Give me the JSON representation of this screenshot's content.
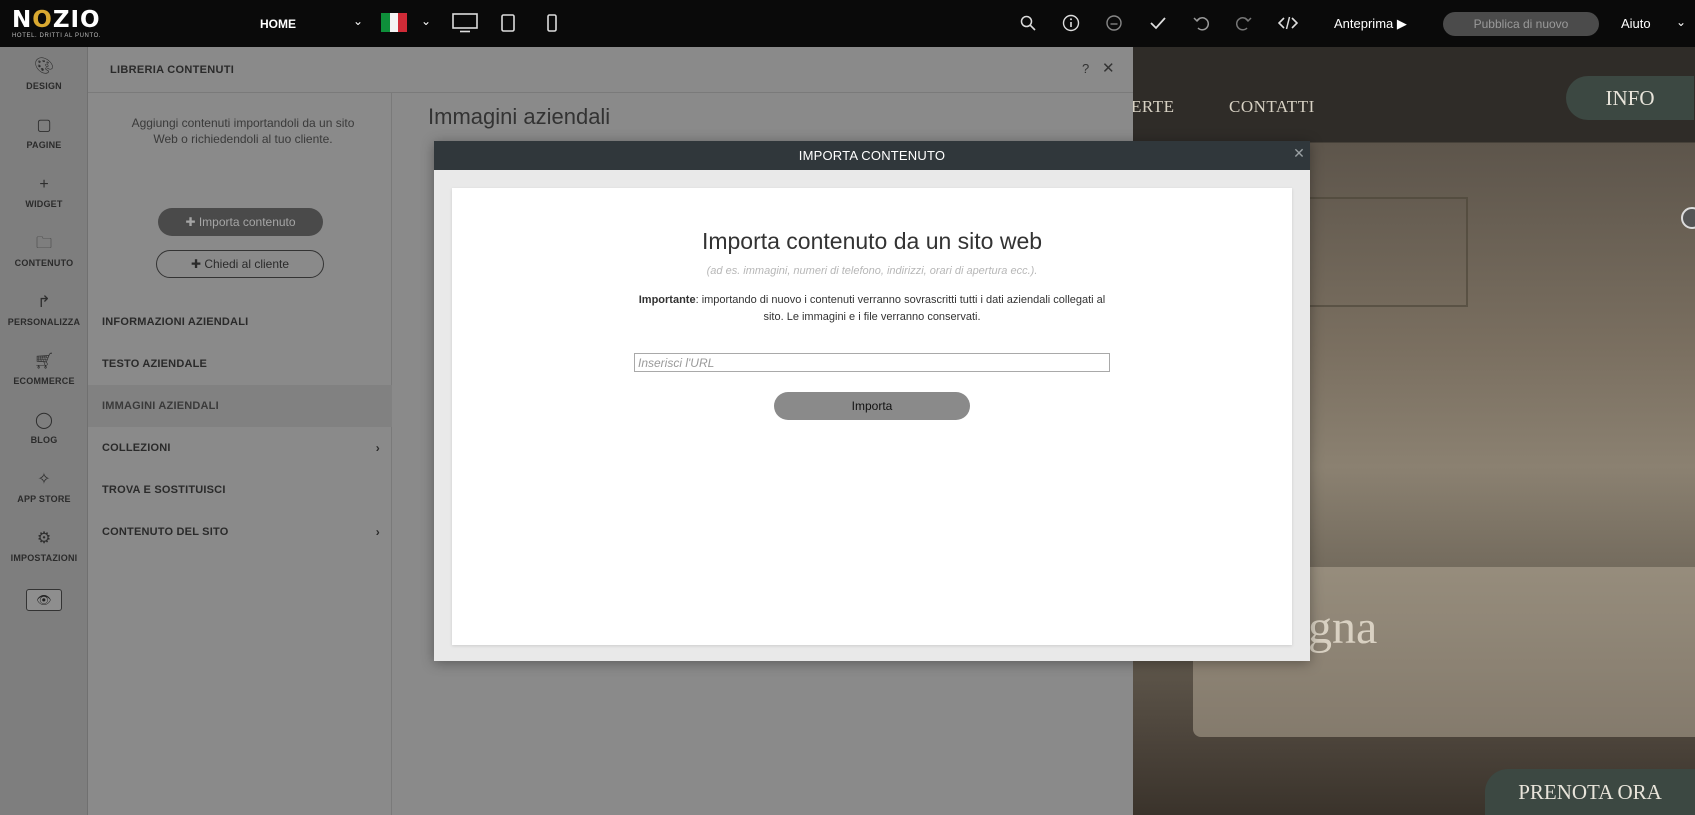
{
  "topbar": {
    "logo_word_pre": "N",
    "logo_word_o": "O",
    "logo_word_post": "ZIO",
    "logo_tagline": "HOTEL. DRITTI AL PUNTO.",
    "page_select": "HOME",
    "preview_label": "Anteprima ▶",
    "publish_label": "Pubblica di nuovo",
    "help_label": "Aiuto",
    "caret": "⌄",
    "flag_colors": [
      "#0e8f3a",
      "#f4f4f4",
      "#cf2b37"
    ]
  },
  "rail": {
    "items": [
      {
        "label": "DESIGN",
        "icon": "palette-icon",
        "glyph": "🎨︎"
      },
      {
        "label": "PAGINE",
        "icon": "pages-icon",
        "glyph": "▢"
      },
      {
        "label": "WIDGET",
        "icon": "plus-icon",
        "glyph": "+"
      },
      {
        "label": "CONTENUTO",
        "icon": "folder-icon",
        "glyph": "🗀"
      },
      {
        "label": "PERSONALIZZA",
        "icon": "route-icon",
        "glyph": "↱"
      },
      {
        "label": "ECOMMERCE",
        "icon": "cart-icon",
        "glyph": "🛒︎"
      },
      {
        "label": "BLOG",
        "icon": "chat-bubble-icon",
        "glyph": "◯"
      },
      {
        "label": "APP STORE",
        "icon": "puzzle-icon",
        "glyph": "✧"
      },
      {
        "label": "IMPOSTAZIONI",
        "icon": "gear-icon",
        "glyph": "⚙"
      }
    ],
    "eye_glyph": "👁︎"
  },
  "panel": {
    "title": "LIBRERIA CONTENUTI",
    "help": "?",
    "close": "✕",
    "description": "Aggiungi contenuti importandoli da un sito Web o richiedendoli al tuo cliente.",
    "import_button": "✚  Importa contenuto",
    "ask_button": "✚  Chiedi al cliente",
    "menu": [
      {
        "label": "INFORMAZIONI AZIENDALI",
        "chevron": ""
      },
      {
        "label": "TESTO AZIENDALE",
        "chevron": ""
      },
      {
        "label": "IMMAGINI AZIENDALI",
        "chevron": ""
      },
      {
        "label": "COLLEZIONI",
        "chevron": "›"
      },
      {
        "label": "TROVA E SOSTITUISCI",
        "chevron": ""
      },
      {
        "label": "CONTENUTO DEL SITO",
        "chevron": "›"
      }
    ],
    "main_title": "Immagini aziendali"
  },
  "preview": {
    "nav_offerte": "ERTE",
    "nav_contatti": "CONTATTI",
    "info_button": "INFO",
    "hero_text": "gna",
    "prenota_button": "PRENOTA ORA"
  },
  "modal": {
    "title": "IMPORTA CONTENUTO",
    "close": "✕",
    "heading": "Importa contenuto da un sito web",
    "subheading": "(ad es. immagini, numeri di telefono, indirizzi, orari di apertura ecc.).",
    "note_bold": "Importante",
    "note_text": ": importando di nuovo i contenuti verranno sovrascritti tutti i dati aziendali collegati al sito. Le immagini e i file verranno conservati.",
    "url_placeholder": "Inserisci l'URL",
    "import_button": "Importa"
  }
}
